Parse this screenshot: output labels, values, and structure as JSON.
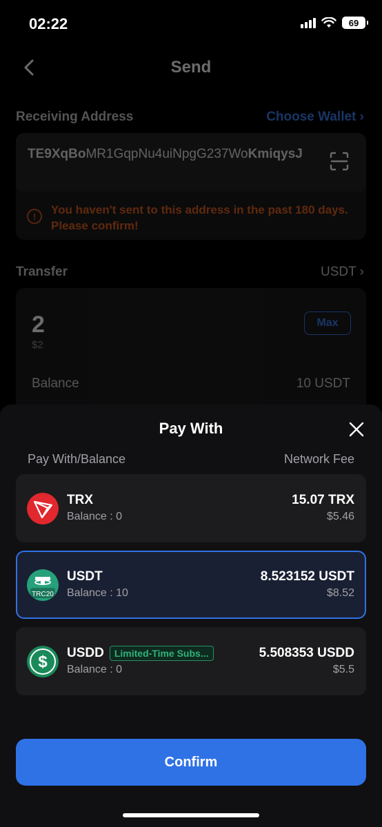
{
  "status_bar": {
    "time": "02:22",
    "battery": "69"
  },
  "header": {
    "title": "Send"
  },
  "receiving": {
    "label": "Receiving Address",
    "choose_wallet": "Choose Wallet",
    "address_start": "TE9XqBo",
    "address_middle": "MR1GqpNu4uiNpgG237Wo",
    "address_end": "KmiqysJ",
    "warning": "You haven't sent to this address in the past 180 days. Please confirm!"
  },
  "transfer": {
    "label": "Transfer",
    "token": "USDT",
    "amount": "2",
    "amount_usd": "$2",
    "max_label": "Max",
    "balance_label": "Balance",
    "balance_value": "10 USDT"
  },
  "sheet": {
    "title": "Pay With",
    "col_left": "Pay With/Balance",
    "col_right": "Network Fee",
    "options": [
      {
        "name": "TRX",
        "balance": "Balance : 0",
        "fee": "15.07 TRX",
        "fee_usd": "$5.46",
        "icon": "tron-icon",
        "color": "#e53935"
      },
      {
        "name": "USDT",
        "balance": "Balance : 10",
        "fee": "8.523152 USDT",
        "fee_usd": "$8.52",
        "icon": "tether-trc20-icon",
        "color": "#26a17b",
        "icon_label": "TRC20",
        "selected": true
      },
      {
        "name": "USDD",
        "badge": "Limited-Time Subs...",
        "balance": "Balance : 0",
        "fee": "5.508353 USDD",
        "fee_usd": "$5.5",
        "icon": "usdd-icon",
        "color": "#1a8a5a"
      }
    ],
    "confirm": "Confirm"
  },
  "colors": {
    "accent": "#2f72e6",
    "warning": "#e2621f",
    "background": "#000000",
    "sheet": "#101012"
  }
}
